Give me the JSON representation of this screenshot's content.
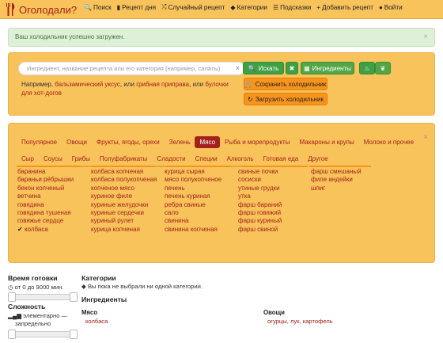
{
  "brand": {
    "name": "Оголодали?"
  },
  "nav": [
    {
      "icon": "search-icon",
      "glyph": "🔍",
      "label": "Поиск"
    },
    {
      "icon": "book-icon",
      "glyph": "▮",
      "label": "Рецепт дня"
    },
    {
      "icon": "shuffle-icon",
      "glyph": "⤮",
      "label": "Случайный рецепт"
    },
    {
      "icon": "tags-icon",
      "glyph": "◆",
      "label": "Категории"
    },
    {
      "icon": "list-icon",
      "glyph": "☰",
      "label": "Подсказки"
    },
    {
      "icon": "plus-icon",
      "glyph": "+",
      "label": "Добавить рецепт"
    },
    {
      "icon": "user-icon",
      "glyph": "●",
      "label": "Войти"
    }
  ],
  "alert": {
    "text": "Ваш холодильник успешно загружен.",
    "close": "×"
  },
  "search": {
    "placeholder": "Ингредиент, название рецепта или его категория (например, салаты)",
    "clear": "×",
    "search_btn": "Искать",
    "reset_btn": "✖",
    "ingredients_btn": "Ингредиенты",
    "save_fridge": "Сохранить холодильник",
    "load_fridge": "Загрузить холодильник",
    "example_prefix": "Например,",
    "example_1": "бальзамический уксус",
    "example_sep": ", или",
    "example_2": "грибная приправа",
    "example_sep2": ", или",
    "example_3": "булочки для хот-догов"
  },
  "categories_panel": {
    "close": "×",
    "tabs_row1": [
      "Популярное",
      "Овощи",
      "Фрукты, ягоды, орехи",
      "Зелень",
      "Мясо",
      "Рыба и морепродукты",
      "Макароны и крупы",
      "Молоко и прочее"
    ],
    "tabs_row2": [
      "Сыр",
      "Соусы",
      "Грибы",
      "Полуфабрикаты",
      "Сладости",
      "Специи",
      "Алкоголь",
      "Готовая еда",
      "Другое"
    ],
    "active_tab": "Мясо",
    "columns": [
      [
        "баранина",
        "бараньи рёбрышки",
        "бекон копченый",
        "ветчина",
        "говядина",
        "говядина тушеная",
        "говяжье сердце",
        "колбаса"
      ],
      [
        "колбаса копченая",
        "колбаса полукопченая",
        "копченое мясо",
        "куриное филе",
        "куриные желудочки",
        "куриные сердечки",
        "куриный рулет",
        "курица копченая"
      ],
      [
        "курица сырая",
        "мясо полукопченое",
        "печень",
        "печень куриная",
        "ребра свиные",
        "сало",
        "свинина",
        "свинина копченая"
      ],
      [
        "свиные почки",
        "сосиски",
        "утиные грудки",
        "утка",
        "фарш бараний",
        "фарш говяжий",
        "фарш куриный",
        "фарш свиной"
      ],
      [
        "фарш смешаный",
        "филе индейки",
        "шпиг"
      ]
    ],
    "checked_item": "колбаса"
  },
  "filters": {
    "time_title": "Время готовки",
    "time_text": "от 0 до 9000 мин.",
    "time_range": [
      0,
      9000
    ],
    "difficulty_title": "Сложность",
    "difficulty_text_1": "элементарно —",
    "difficulty_text_2": "запредельно"
  },
  "selection": {
    "categories_title": "Категории",
    "categories_text": "Вы пока не выбрали ни одной категории.",
    "ingredients_title": "Ингредиенты",
    "group_meat": "Мясо",
    "group_meat_items": "колбаса",
    "group_veg": "Овощи",
    "group_veg_items": "огурцы, лук, картофель"
  },
  "colors": {
    "accent": "#f8c35a",
    "brand_red": "#a3221b",
    "green": "#3fa144",
    "orange": "#f7941e",
    "alert_bg": "#dff0d8"
  }
}
